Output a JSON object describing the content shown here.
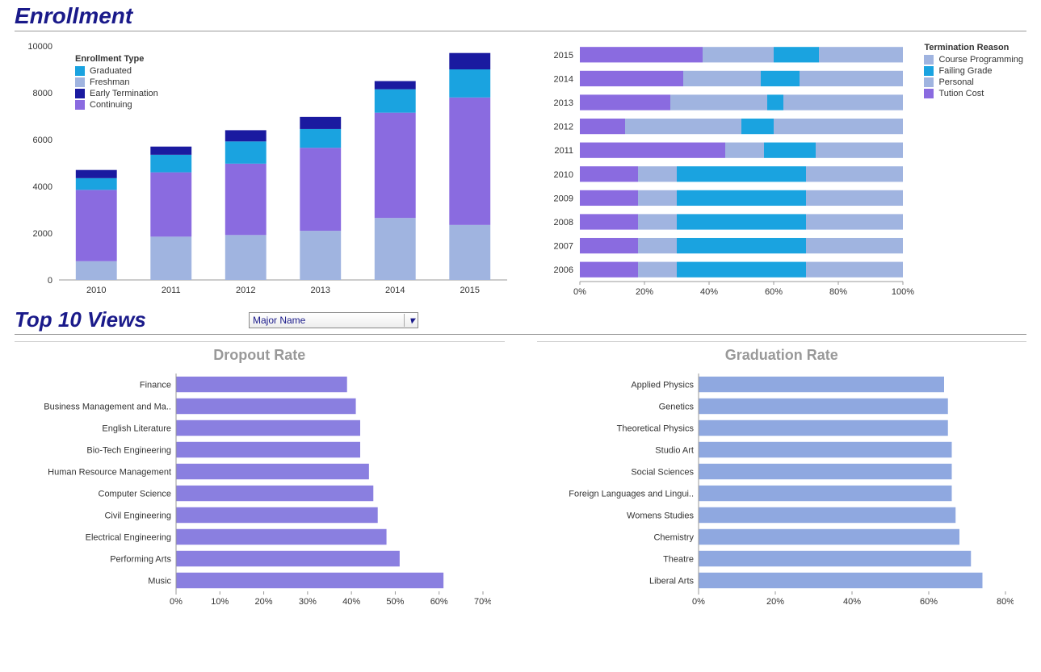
{
  "titles": {
    "enrollment": "Enrollment",
    "top10": "Top 10 Views",
    "dropout": "Dropout Rate",
    "graduation": "Graduation Rate"
  },
  "dropdown": {
    "selected": "Major Name"
  },
  "legends": {
    "enrollment": {
      "title": "Enrollment Type",
      "items": [
        {
          "label": "Graduated",
          "color": "#1aa3e0"
        },
        {
          "label": "Freshman",
          "color": "#a0b4e0"
        },
        {
          "label": "Early Termination",
          "color": "#1a1aa0"
        },
        {
          "label": "Continuing",
          "color": "#8a6be0"
        }
      ]
    },
    "termination": {
      "title": "Termination Reason",
      "items": [
        {
          "label": "Course Programming",
          "color": "#a0b4e0"
        },
        {
          "label": "Failing Grade",
          "color": "#1aa3e0"
        },
        {
          "label": "Personal",
          "color": "#a0b4e0"
        },
        {
          "label": "Tution Cost",
          "color": "#8a6be0"
        }
      ]
    }
  },
  "chart_data": [
    {
      "id": "enrollment_stacked",
      "type": "bar",
      "stacked": true,
      "orientation": "vertical",
      "xlabel": "",
      "ylabel": "",
      "ylim": [
        0,
        10000
      ],
      "yticks": [
        0,
        2000,
        4000,
        6000,
        8000,
        10000
      ],
      "categories": [
        "2010",
        "2011",
        "2012",
        "2013",
        "2014",
        "2015"
      ],
      "series": [
        {
          "name": "Freshman",
          "color": "#a0b4e0",
          "values": [
            800,
            1850,
            1920,
            2100,
            2650,
            2350
          ]
        },
        {
          "name": "Continuing",
          "color": "#8a6be0",
          "values": [
            3050,
            2750,
            3050,
            3550,
            4500,
            5450
          ]
        },
        {
          "name": "Graduated",
          "color": "#1aa3e0",
          "values": [
            500,
            750,
            950,
            800,
            1000,
            1200
          ]
        },
        {
          "name": "Early Termination",
          "color": "#1a1aa0",
          "values": [
            350,
            350,
            480,
            520,
            350,
            700
          ]
        }
      ]
    },
    {
      "id": "termination_stacked",
      "type": "bar",
      "stacked": true,
      "orientation": "horizontal",
      "unit": "percent",
      "xlim": [
        0,
        100
      ],
      "xticks": [
        0,
        20,
        40,
        60,
        80,
        100
      ],
      "categories": [
        "2006",
        "2007",
        "2008",
        "2009",
        "2010",
        "2011",
        "2012",
        "2013",
        "2014",
        "2015"
      ],
      "series": [
        {
          "name": "Tution Cost",
          "color": "#8a6be0",
          "values": [
            18,
            18,
            18,
            18,
            18,
            45,
            14,
            28,
            32,
            38
          ]
        },
        {
          "name": "Course Programming",
          "color": "#a0b4e0",
          "values": [
            12,
            12,
            12,
            12,
            12,
            12,
            36,
            30,
            24,
            22
          ]
        },
        {
          "name": "Failing Grade",
          "color": "#1aa3e0",
          "values": [
            40,
            40,
            40,
            40,
            40,
            16,
            10,
            5,
            12,
            14
          ]
        },
        {
          "name": "Personal",
          "color": "#a0b4e0",
          "values": [
            30,
            30,
            30,
            30,
            30,
            27,
            40,
            37,
            32,
            26
          ]
        }
      ]
    },
    {
      "id": "dropout_rate",
      "type": "bar",
      "orientation": "horizontal",
      "xlabel": "",
      "ylabel": "",
      "xlim": [
        0,
        70
      ],
      "xticks": [
        0,
        10,
        20,
        30,
        40,
        50,
        60,
        70
      ],
      "unit": "percent",
      "color": "#8a7fe0",
      "categories": [
        "Finance",
        "Business Management and Ma..",
        "English Literature",
        "Bio-Tech Engineering",
        "Human Resource Management",
        "Computer Science",
        "Civil Engineering",
        "Electrical Engineering",
        "Performing Arts",
        "Music"
      ],
      "values": [
        39,
        41,
        42,
        42,
        44,
        45,
        46,
        48,
        51,
        61
      ]
    },
    {
      "id": "graduation_rate",
      "type": "bar",
      "orientation": "horizontal",
      "xlabel": "",
      "ylabel": "",
      "xlim": [
        0,
        80
      ],
      "xticks": [
        0,
        20,
        40,
        60,
        80
      ],
      "unit": "percent",
      "color": "#8fa8e0",
      "categories": [
        "Applied Physics",
        "Genetics",
        "Theoretical Physics",
        "Studio Art",
        "Social Sciences",
        "Foreign Languages and Lingui..",
        "Womens Studies",
        "Chemistry",
        "Theatre",
        "Liberal Arts"
      ],
      "values": [
        64,
        65,
        65,
        66,
        66,
        66,
        67,
        68,
        71,
        74
      ]
    }
  ]
}
